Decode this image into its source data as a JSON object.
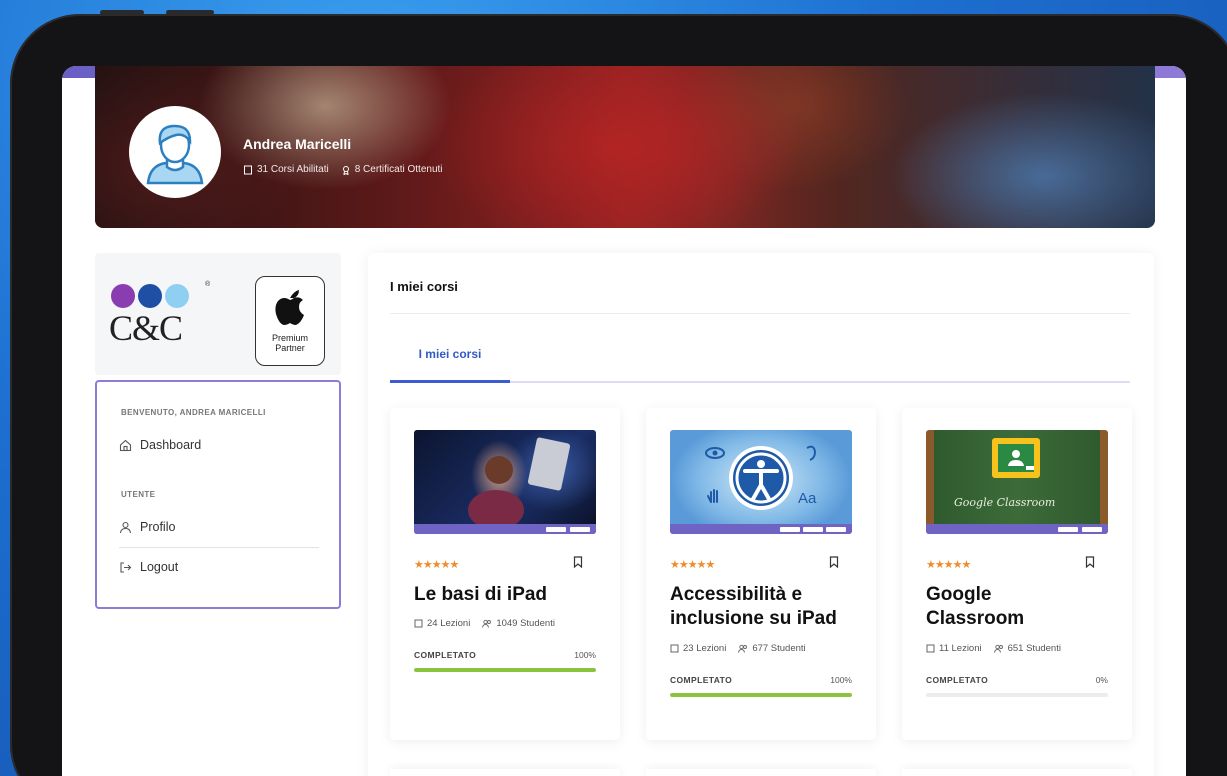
{
  "colors": {
    "accent": "#3d5ccf",
    "progress": "#8ac43f",
    "stars": "#f08c2c",
    "menu_border": "#8d7dd6"
  },
  "profile": {
    "name": "Andrea Maricelli",
    "courses": "31 Corsi Abilitati",
    "certificates": "8 Certificati Ottenuti"
  },
  "brand": {
    "logo_text": "C&C",
    "logo_reg": "®",
    "partner_label": "Premium Partner"
  },
  "sidebar": {
    "welcome": "BENVENUTO, ANDREA MARICELLI",
    "dashboard": "Dashboard",
    "user_section": "UTENTE",
    "profile": "Profilo",
    "logout": "Logout"
  },
  "main": {
    "title": "I miei corsi",
    "tab": "I miei corsi"
  },
  "courses": [
    {
      "title": "Le basi di iPad",
      "lessons": "24 Lezioni",
      "students": "1049 Studenti",
      "status": "COMPLETATO",
      "percent": "100%",
      "progress": 1.0,
      "rating": "★★★★★"
    },
    {
      "title": "Accessibilità e inclusione su iPad",
      "lessons": "23 Lezioni",
      "students": "677 Studenti",
      "status": "COMPLETATO",
      "percent": "100%",
      "progress": 1.0,
      "rating": "★★★★★"
    },
    {
      "title": "Google Classroom",
      "lessons": "11 Lezioni",
      "students": "651 Studenti",
      "status": "COMPLETATO",
      "percent": "0%",
      "progress": 0.0,
      "rating": "★★★★★"
    }
  ],
  "thumb_text": {
    "classroom": "Google Classroom",
    "aa": "Aa"
  }
}
